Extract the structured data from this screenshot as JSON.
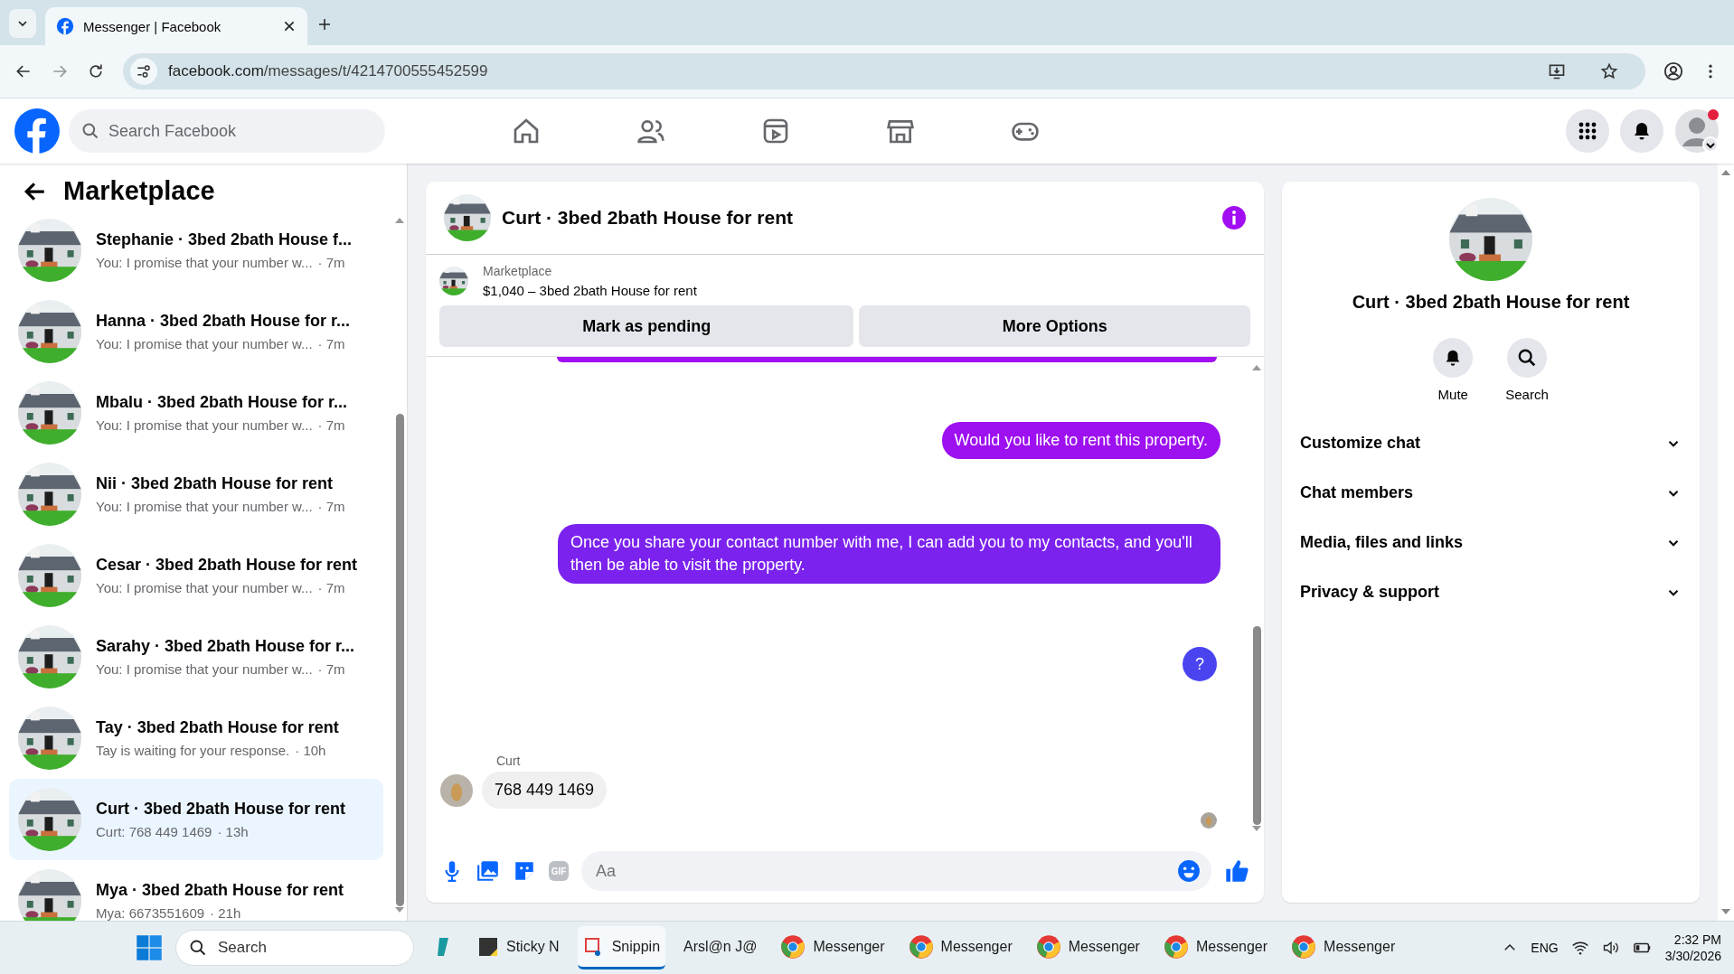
{
  "browser": {
    "tab_title": "Messenger | Facebook",
    "url_domain": "facebook.com",
    "url_path": "/messages/t/4214700555452599"
  },
  "header": {
    "search_placeholder": "Search Facebook"
  },
  "sidebar": {
    "title": "Marketplace",
    "conversations": [
      {
        "name": "Stephanie · 3bed 2bath House f...",
        "preview": "You: I promise that your number w...",
        "time": "· 7m",
        "selected": false
      },
      {
        "name": "Hanna · 3bed 2bath House for r...",
        "preview": "You: I promise that your number w...",
        "time": "· 7m",
        "selected": false
      },
      {
        "name": "Mbalu · 3bed 2bath House for r...",
        "preview": "You: I promise that your number w...",
        "time": "· 7m",
        "selected": false
      },
      {
        "name": "Nii · 3bed 2bath House for rent",
        "preview": "You: I promise that your number w...",
        "time": "· 7m",
        "selected": false
      },
      {
        "name": "Cesar · 3bed 2bath House for rent",
        "preview": "You: I promise that your number w...",
        "time": "· 7m",
        "selected": false
      },
      {
        "name": "Sarahy · 3bed 2bath House for r...",
        "preview": "You: I promise that your number w...",
        "time": "· 7m",
        "selected": false
      },
      {
        "name": "Tay · 3bed 2bath House for rent",
        "preview": "Tay is waiting for your response.",
        "time": "· 10h",
        "selected": false
      },
      {
        "name": "Curt · 3bed 2bath House for rent",
        "preview": "Curt: 768 449 1469",
        "time": "· 13h",
        "selected": true
      },
      {
        "name": "Mya · 3bed 2bath House for rent",
        "preview": "Mya: 6673551609",
        "time": "· 21h",
        "selected": false
      }
    ]
  },
  "chat": {
    "title": "Curt · 3bed 2bath House for rent",
    "listing": {
      "label": "Marketplace",
      "title": "$1,040 – 3bed 2bath House for rent"
    },
    "buttons": [
      "Mark as pending",
      "More Options"
    ],
    "messages": [
      {
        "kind": "clipped",
        "color": "#a20ef2"
      },
      {
        "kind": "sent",
        "text": "Would you like to rent this property.",
        "color": "#9d10f0"
      },
      {
        "kind": "sent",
        "text": "Once you share your contact number with me, I can add you to my contacts, and you'll then be able to visit the property.",
        "color": "#7b22ee"
      },
      {
        "kind": "sent_round",
        "text": "?",
        "color": "#4a44f0"
      },
      {
        "kind": "received",
        "sender": "Curt",
        "text": "768 449 1469"
      }
    ],
    "composer": {
      "gif_label": "GIF",
      "placeholder": "Aa"
    }
  },
  "details": {
    "title": "Curt · 3bed 2bath House for rent",
    "actions": [
      {
        "kind": "mute",
        "label": "Mute"
      },
      {
        "kind": "search",
        "label": "Search"
      }
    ],
    "sections": [
      "Customize chat",
      "Chat members",
      "Media, files and links",
      "Privacy & support"
    ]
  },
  "taskbar": {
    "search_placeholder": "Search",
    "apps": [
      {
        "kind": "vpn",
        "active": false
      },
      {
        "kind": "sticky",
        "label": "Sticky N",
        "active": false
      },
      {
        "kind": "snip",
        "label": "Snippin",
        "active": true
      },
      {
        "kind": "text",
        "label": "Arsl@n J@",
        "active": false
      },
      {
        "kind": "chrome",
        "label": "Messenger",
        "active": false
      },
      {
        "kind": "chrome",
        "label": "Messenger",
        "active": false
      },
      {
        "kind": "chrome",
        "label": "Messenger",
        "active": false
      },
      {
        "kind": "chrome",
        "label": "Messenger",
        "active": false
      },
      {
        "kind": "chrome",
        "label": "Messenger",
        "active": false
      }
    ],
    "language": "ENG",
    "time": "2:32 PM",
    "date": "3/30/2026"
  }
}
